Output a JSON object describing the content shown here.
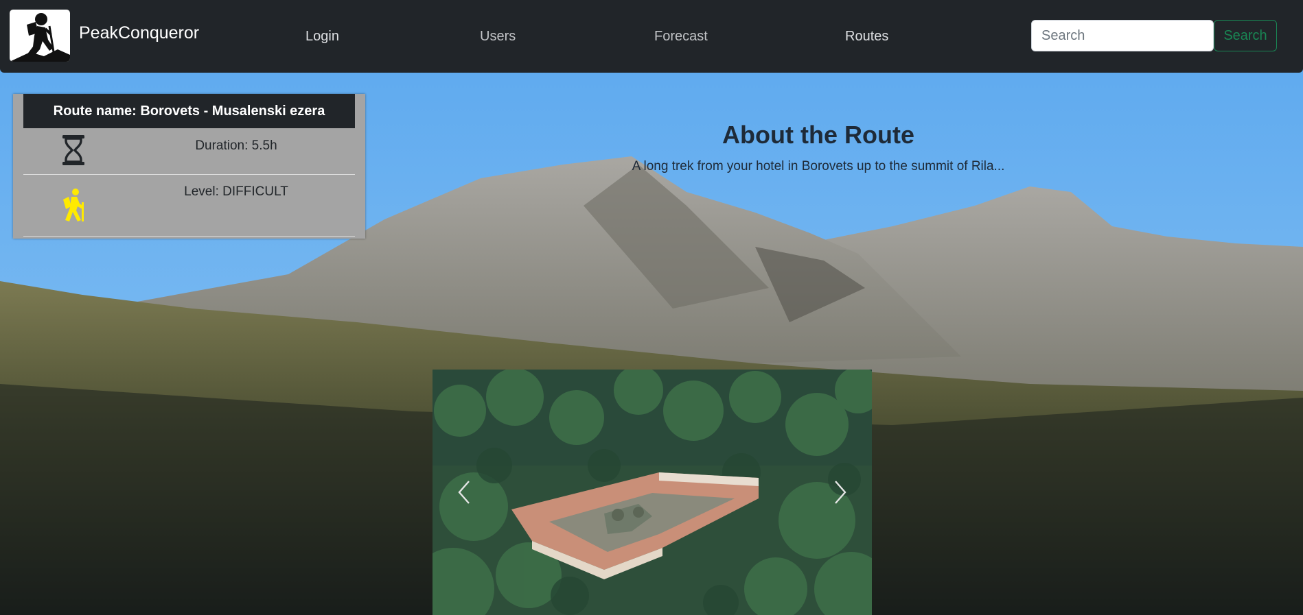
{
  "navbar": {
    "brand": "PeakConqueror",
    "links": [
      "Login",
      "Users",
      "Forecast",
      "Routes"
    ],
    "search_placeholder": "Search",
    "search_button": "Search"
  },
  "route": {
    "name_label": "Route name: Borovets - Musalenski ezera",
    "duration_label": "Duration: 5.5h",
    "level_label": "Level: DIFFICULT"
  },
  "about": {
    "title": "About the Route",
    "text": "A long trek from your hotel in Borovets up to the summit of Rila..."
  },
  "icons": {
    "logo": "hiker-logo-icon",
    "duration": "hourglass-icon",
    "level": "hiking-icon",
    "prev": "chevron-left-icon",
    "next": "chevron-right-icon"
  },
  "colors": {
    "navbar_bg": "#212529",
    "search_button_accent": "#198754",
    "level_icon": "#ffea00",
    "card_bg": "#a4a4a4"
  }
}
